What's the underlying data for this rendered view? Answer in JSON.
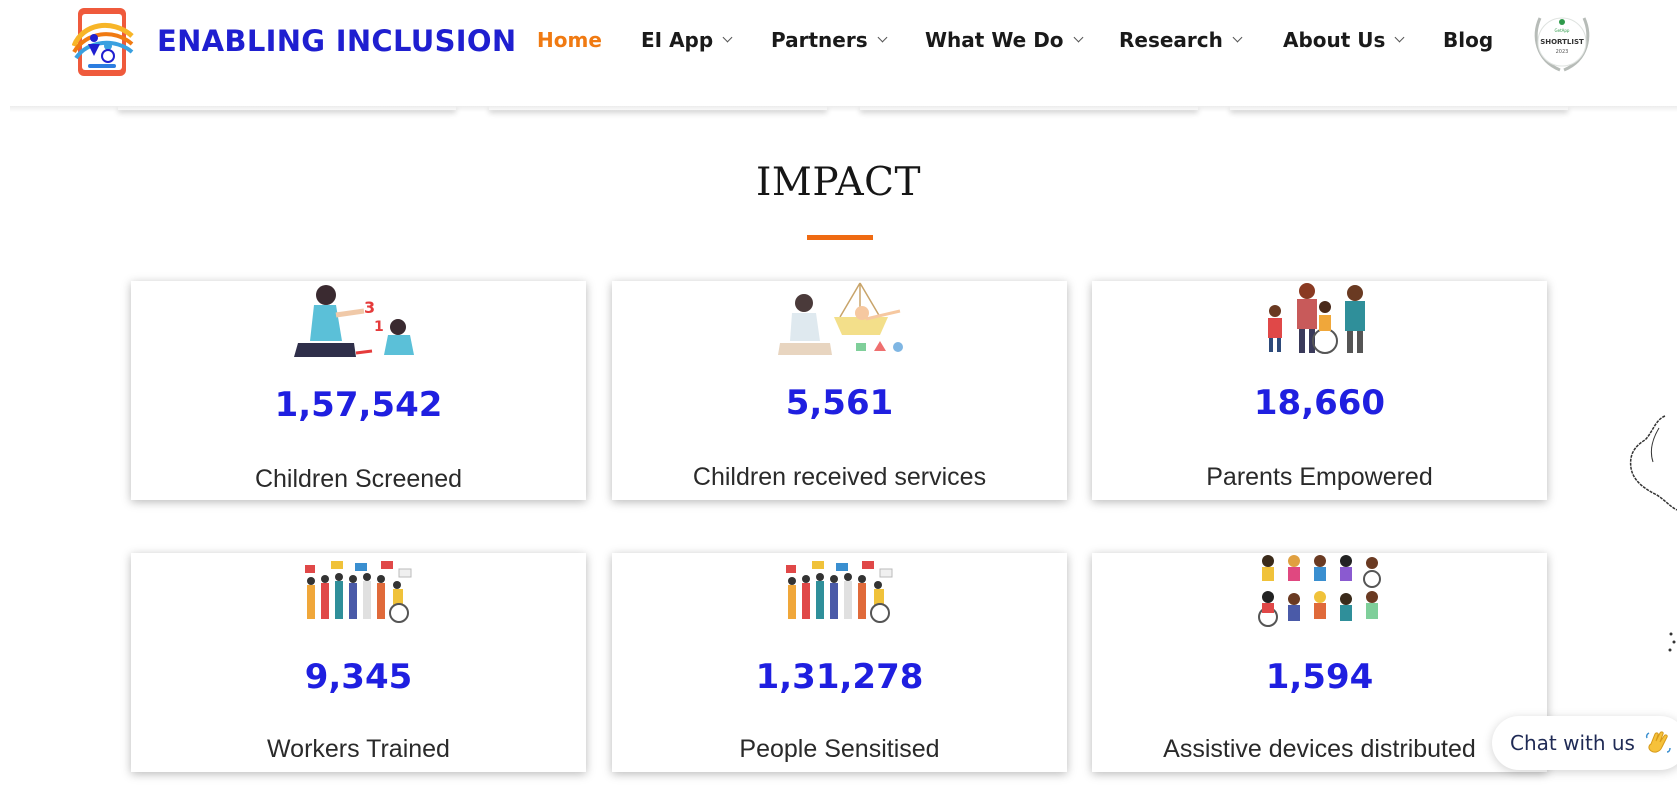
{
  "header": {
    "brand": "ENABLING INCLUSION",
    "nav": [
      {
        "label": "Home",
        "active": true,
        "dropdown": false
      },
      {
        "label": "EI App",
        "active": false,
        "dropdown": true
      },
      {
        "label": "Partners",
        "active": false,
        "dropdown": true
      },
      {
        "label": "What We Do",
        "active": false,
        "dropdown": true
      },
      {
        "label": "Research",
        "active": false,
        "dropdown": true
      },
      {
        "label": "About Us",
        "active": false,
        "dropdown": true
      },
      {
        "label": "Blog",
        "active": false,
        "dropdown": false
      }
    ],
    "award_badge_text": "SHORTLIST",
    "award_badge_year": "2023"
  },
  "impact": {
    "title": "IMPACT",
    "cards": [
      {
        "value": "1,57,542",
        "label": "Children Screened",
        "icon": "mother-child-playing-illustration"
      },
      {
        "value": "5,561",
        "label": "Children received services",
        "icon": "therapy-session-illustration"
      },
      {
        "value": "18,660",
        "label": "Parents Empowered",
        "icon": "family-group-illustration"
      },
      {
        "value": "9,345",
        "label": "Workers Trained",
        "icon": "people-with-placards-illustration"
      },
      {
        "value": "1,31,278",
        "label": "People Sensitised",
        "icon": "people-with-placards-illustration"
      },
      {
        "value": "1,594",
        "label": "Assistive devices distributed",
        "icon": "children-with-wheelchairs-illustration"
      }
    ]
  },
  "chat": {
    "label": "Chat with us",
    "icon": "waving-hand-icon"
  },
  "colors": {
    "brand_blue": "#1f1fd0",
    "accent_orange": "#f07a12",
    "stat_blue": "#1f1fe0"
  }
}
